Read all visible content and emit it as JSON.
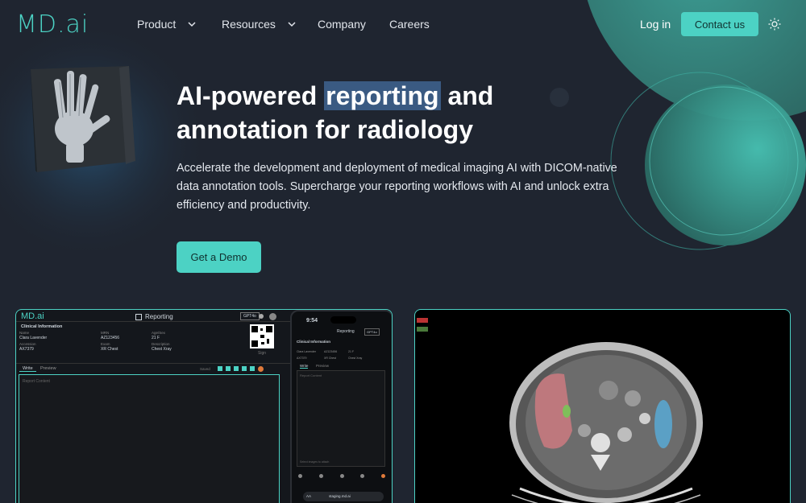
{
  "nav": {
    "logo_main": "MD",
    "logo_suffix": ".ai",
    "product": "Product",
    "resources": "Resources",
    "company": "Company",
    "careers": "Careers",
    "login": "Log in",
    "contact": "Contact us",
    "theme_icon": "sun-icon"
  },
  "hero": {
    "title_pre": "AI-powered ",
    "title_highlight": "reporting",
    "title_post": " and annotation for radiology",
    "description": "Accelerate the development and deployment of medical imaging AI with DICOM-native data annotation tools. Supercharge your reporting workflows with AI and unlock extra efficiency and productivity.",
    "cta": "Get a Demo"
  },
  "reporting_app": {
    "logo": "MD.ai",
    "title": "Reporting",
    "gpt_badge": "GPT4o",
    "section": "Clinical Information",
    "fields": [
      {
        "label": "Name",
        "value": "Clara Lavender"
      },
      {
        "label": "MRN",
        "value": "AZ123456"
      },
      {
        "label": "Age/Sex",
        "value": "21 F"
      },
      {
        "label": "Accession",
        "value": "AX7379"
      },
      {
        "label": "Exam",
        "value": "XR Chest"
      },
      {
        "label": "Description",
        "value": "Chest Xray"
      }
    ],
    "sign": "Sign",
    "tab_write": "Write",
    "tab_preview": "Preview",
    "saved": "Saved",
    "placeholder": "Report Content"
  },
  "phone": {
    "time": "9:54",
    "title": "Reporting",
    "badge": "GPT4o",
    "section": "Clinical Information",
    "tab_write": "Write",
    "tab_preview": "Preview",
    "placeholder": "Report Content",
    "attach": "Select images to attach",
    "url": "staging.md.ai",
    "aa": "AA"
  },
  "colors": {
    "accent": "#4cd2c4",
    "background": "#1f2530",
    "highlight": "#3a5a82"
  }
}
